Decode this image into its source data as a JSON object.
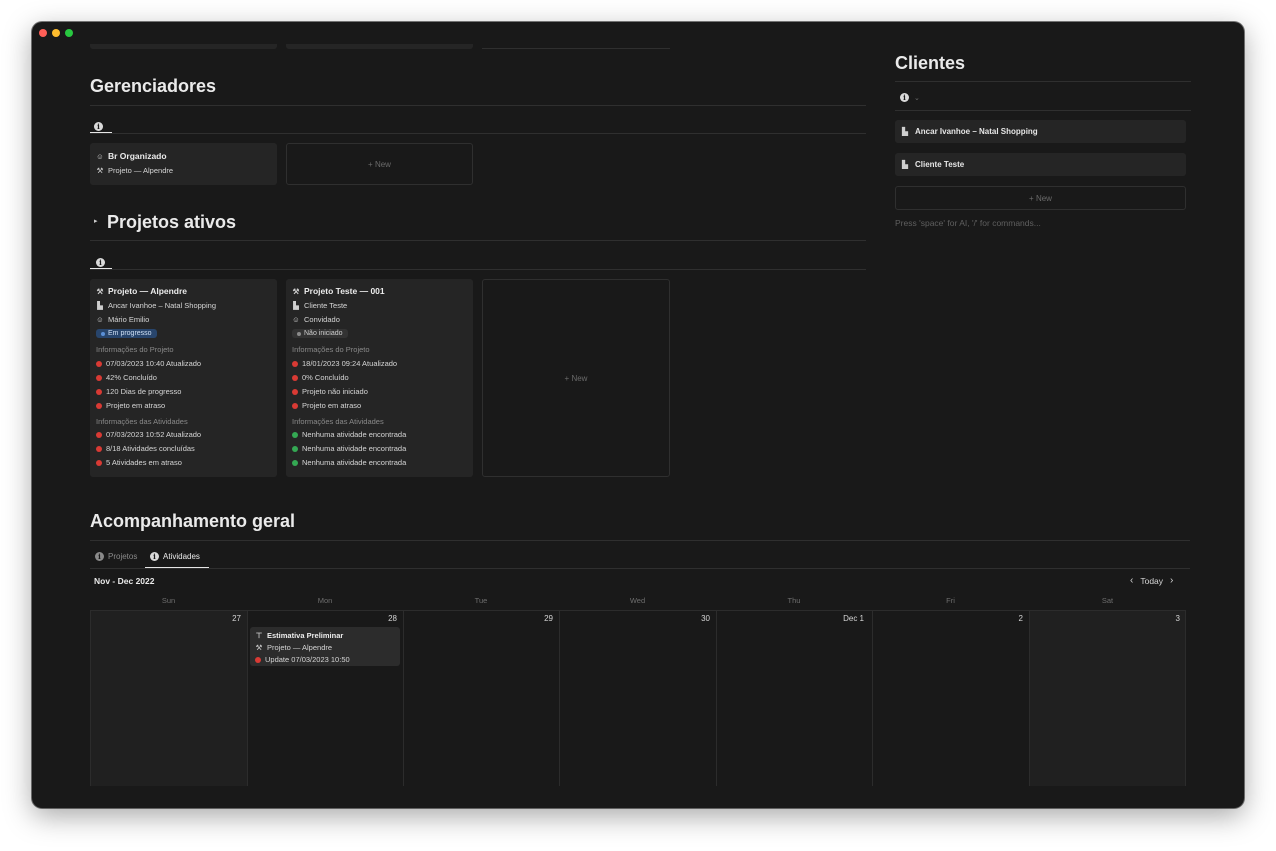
{
  "gerenciadores": {
    "title": "Gerenciadores",
    "card": {
      "title": "Br Organizado",
      "project": "Projeto — Alpendre"
    },
    "new_label": "+ New"
  },
  "projetos": {
    "title": "Projetos ativos",
    "new_label": "+ New",
    "cards": [
      {
        "title": "Projeto — Alpendre",
        "client": "Ancar Ivanhoe – Natal Shopping",
        "person": "Mário Emilio",
        "status": "Em progresso",
        "info_header": "Informações do Projeto",
        "info": [
          "07/03/2023 10:40 Atualizado",
          "42% Concluído",
          "120 Dias de progresso",
          "Projeto em atraso"
        ],
        "act_header": "Informações das Atividades",
        "activities": [
          "07/03/2023 10:52 Atualizado",
          "8/18 Atividades concluídas",
          "5 Atividades em atraso"
        ]
      },
      {
        "title": "Projeto Teste — 001",
        "client": "Cliente Teste",
        "person": "Convidado",
        "status": "Não iniciado",
        "info_header": "Informações do Projeto",
        "info": [
          "18/01/2023 09:24 Atualizado",
          "0% Concluído",
          "Projeto não iniciado",
          "Projeto em atraso"
        ],
        "act_header": "Informações das Atividades",
        "activities": [
          "Nenhuma atividade encontrada",
          "Nenhuma atividade encontrada",
          "Nenhuma atividade encontrada"
        ]
      }
    ]
  },
  "clientes": {
    "title": "Clientes",
    "items": [
      "Ancar Ivanhoe – Natal Shopping",
      "Cliente Teste"
    ],
    "new_label": "+ New",
    "hint": "Press 'space' for AI, '/' for commands..."
  },
  "acompanhamento": {
    "title": "Acompanhamento geral",
    "tabs": [
      "Projetos",
      "Atividades"
    ],
    "range": "Nov - Dec 2022",
    "today": "Today",
    "weekdays": [
      "Sun",
      "Mon",
      "Tue",
      "Wed",
      "Thu",
      "Fri",
      "Sat"
    ],
    "days": [
      "27",
      "28",
      "29",
      "30",
      "Dec 1",
      "2",
      "3"
    ],
    "event": {
      "title": "Estimativa Preliminar",
      "project": "Projeto — Alpendre",
      "update": "Update 07/03/2023 10:50"
    }
  },
  "colors": {
    "red": "#d93a34",
    "green": "#34a853",
    "blue_pill": "#28456c",
    "gray_pill": "#333333"
  },
  "icons": [
    "info-icon",
    "user-circle-icon",
    "hammer-icon",
    "building-icon",
    "pin-icon",
    "chevron-left-icon",
    "chevron-right-icon",
    "chevron-down-icon",
    "triangle-right-icon"
  ]
}
